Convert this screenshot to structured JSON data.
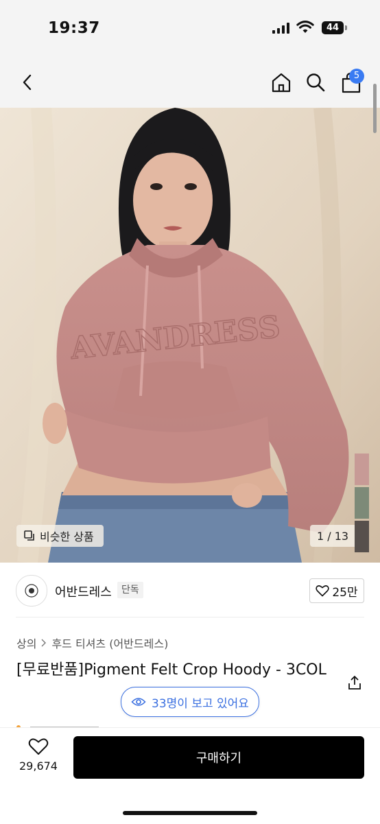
{
  "status": {
    "time": "19:37",
    "battery": "44"
  },
  "nav": {
    "cart_count": "5"
  },
  "hero": {
    "similar_label": "비슷한 상품",
    "page_indicator": "1 / 13",
    "print_text": "AVANDRESS",
    "swatches": [
      "#c79a96",
      "#7d8a78",
      "#57504c"
    ]
  },
  "brand": {
    "name": "어반드레스",
    "tag": "단독",
    "likes": "25만"
  },
  "product": {
    "breadcrumb": [
      "상의",
      "후드 티셔츠 (어반드레스)"
    ],
    "title": "[무료반품]Pigment Felt Crop Hoody - 3COL",
    "viewers": "33명이 보고 있어요"
  },
  "bottom": {
    "wish_count": "29,674",
    "buy_label": "구매하기"
  },
  "colors": {
    "accent": "#3a6fe0",
    "badge": "#3a7bf2",
    "buy_bg": "#000000"
  }
}
